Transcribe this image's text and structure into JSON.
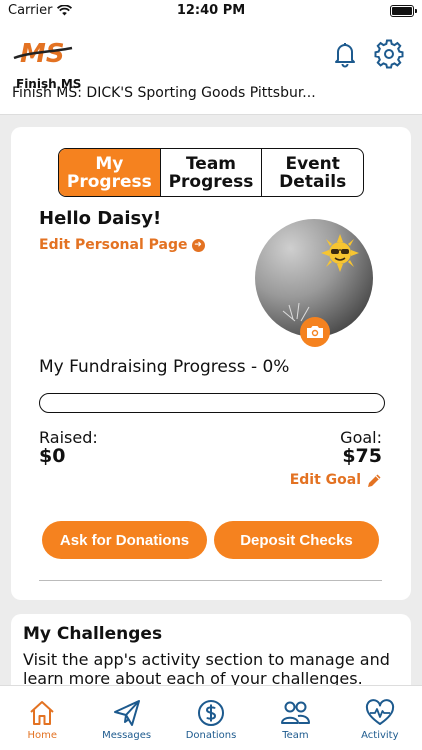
{
  "status_bar": {
    "carrier": "Carrier",
    "time": "12:40 PM"
  },
  "header": {
    "logo_mark": "MS",
    "logo_text": "Finish MS",
    "event_title": "Finish MS: DICK'S Sporting Goods Pittsbur..."
  },
  "segments": [
    {
      "label": "My\nProgress",
      "active": true
    },
    {
      "label": "Team\nProgress",
      "active": false
    },
    {
      "label": "Event\nDetails",
      "active": false
    }
  ],
  "profile": {
    "greeting": "Hello Daisy!",
    "edit_page_link": "Edit Personal Page"
  },
  "fundraising": {
    "title": "My Fundraising Progress - 0%",
    "progress_fraction": 0,
    "raised_label": "Raised:",
    "raised_value": "$0",
    "goal_label": "Goal:",
    "goal_value": "$75",
    "edit_goal_link": "Edit Goal"
  },
  "actions": {
    "ask_label": "Ask for Donations",
    "deposit_label": "Deposit Checks"
  },
  "challenges": {
    "title": "My Challenges",
    "text": "Visit the app's activity section to manage and learn more about each of your challenges."
  },
  "tabs": [
    {
      "label": "Home",
      "icon": "home-icon",
      "active": true
    },
    {
      "label": "Messages",
      "icon": "paper-plane-icon",
      "active": false
    },
    {
      "label": "Donations",
      "icon": "dollar-circle-icon",
      "active": false
    },
    {
      "label": "Team",
      "icon": "team-icon",
      "active": false
    },
    {
      "label": "Activity",
      "icon": "heart-pulse-icon",
      "active": false
    }
  ],
  "colors": {
    "accent": "#f5821f",
    "link": "#e37222",
    "tab_inactive": "#1d5a8e"
  }
}
